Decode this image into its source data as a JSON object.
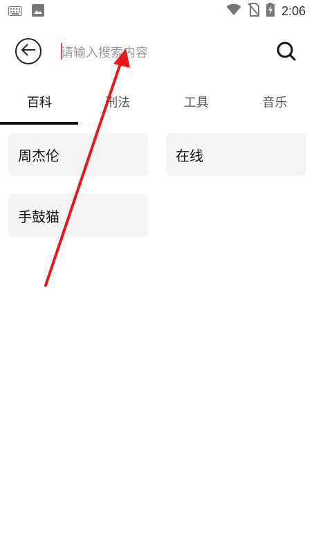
{
  "statusbar": {
    "time": "2:06",
    "icons": [
      "keyboard-icon",
      "image-icon",
      "wifi-icon",
      "no-sim-icon",
      "battery-charging-icon"
    ]
  },
  "search": {
    "placeholder": "请输入搜索内容",
    "value": ""
  },
  "tabs": [
    {
      "label": "百科",
      "active": true
    },
    {
      "label": "刑法",
      "active": false
    },
    {
      "label": "工具",
      "active": false
    },
    {
      "label": "音乐",
      "active": false
    }
  ],
  "suggestions": [
    {
      "label": "周杰伦"
    },
    {
      "label": "在线"
    },
    {
      "label": "手鼓猫"
    }
  ],
  "colors": {
    "caret": "#e8436c",
    "annotation_arrow": "#e81818",
    "card_bg": "#f4f4f4"
  }
}
